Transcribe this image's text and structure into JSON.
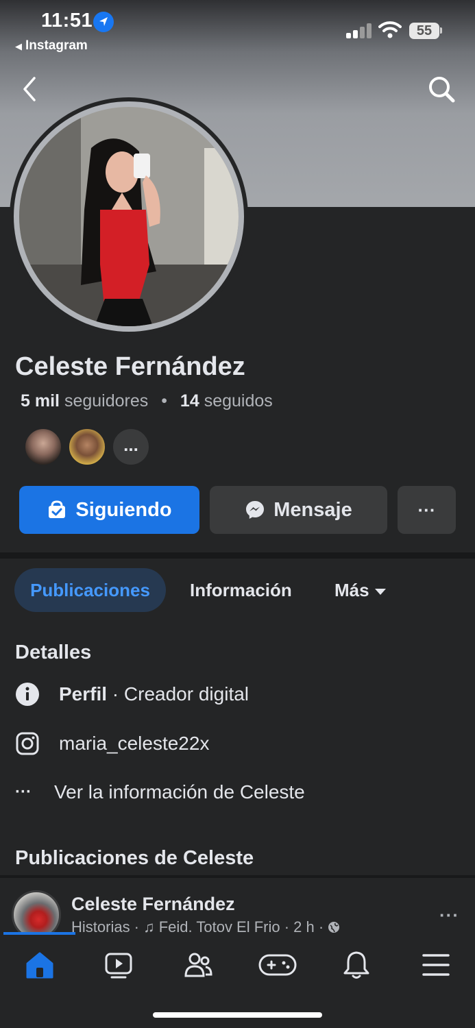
{
  "status_bar": {
    "time": "11:51",
    "back_app": "Instagram",
    "battery": "55"
  },
  "profile": {
    "name": "Celeste Fernández",
    "followers_count": "5 mil",
    "followers_label": "seguidores",
    "separator": "•",
    "following_count": "14",
    "following_label": "seguidos",
    "mutual_more": "..."
  },
  "actions": {
    "follow_label": "Siguiendo",
    "message_label": "Mensaje",
    "more_label": "···"
  },
  "tabs": [
    {
      "label": "Publicaciones",
      "active": true
    },
    {
      "label": "Información",
      "active": false
    },
    {
      "label": "Más",
      "active": false
    }
  ],
  "details": {
    "heading": "Detalles",
    "profile_label": "Perfil",
    "profile_sep": " · ",
    "profile_category": "Creador digital",
    "instagram_handle": "maria_celeste22x",
    "see_more_dots": "···",
    "see_more": "Ver la información de Celeste"
  },
  "posts": {
    "heading": "Publicaciones de Celeste",
    "item": {
      "author": "Celeste Fernández",
      "meta": "Historias · ♫ Feid. Totov El Frio · 2 h · ",
      "more": "···"
    }
  },
  "bottom_nav": [
    {
      "icon": "home-icon",
      "active": true
    },
    {
      "icon": "video-icon",
      "active": false
    },
    {
      "icon": "friends-icon",
      "active": false
    },
    {
      "icon": "gaming-icon",
      "active": false
    },
    {
      "icon": "bell-icon",
      "active": false
    },
    {
      "icon": "menu-icon",
      "active": false
    }
  ],
  "colors": {
    "accent": "#1b74e4",
    "background": "#242526",
    "active_tab_bg": "#263951",
    "active_tab_text": "#4599ff"
  }
}
